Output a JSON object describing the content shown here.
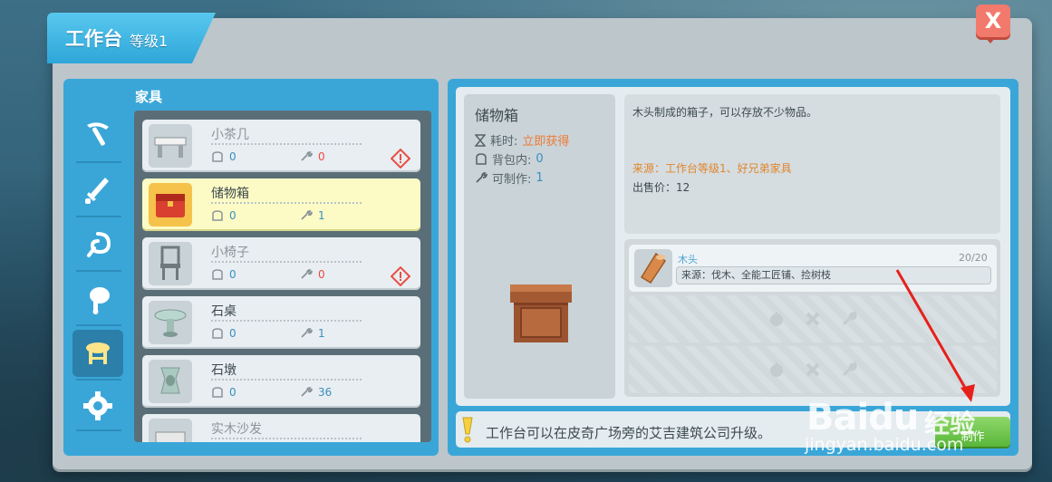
{
  "window": {
    "title": "工作台",
    "level": "等级1"
  },
  "close": {
    "icon": "close-icon",
    "symbol": "X"
  },
  "category": {
    "title": "家具",
    "tabs": [
      {
        "name": "tools",
        "icon": "pickaxe-icon",
        "active": false
      },
      {
        "name": "weapons",
        "icon": "sword-icon",
        "active": false
      },
      {
        "name": "gathering",
        "icon": "hook-icon",
        "active": false
      },
      {
        "name": "food",
        "icon": "meat-icon",
        "active": false
      },
      {
        "name": "furniture",
        "icon": "stool-icon",
        "active": true
      },
      {
        "name": "materials",
        "icon": "gear-icon",
        "active": false
      }
    ]
  },
  "items": [
    {
      "name": "小茶几",
      "bag": "0",
      "craft": "0",
      "available": false,
      "selected": false,
      "warning": true,
      "icon": "tea-table-icon"
    },
    {
      "name": "储物箱",
      "bag": "0",
      "craft": "1",
      "available": true,
      "selected": true,
      "warning": false,
      "icon": "storage-box-icon"
    },
    {
      "name": "小椅子",
      "bag": "0",
      "craft": "0",
      "available": false,
      "selected": false,
      "warning": true,
      "icon": "chair-icon"
    },
    {
      "name": "石桌",
      "bag": "0",
      "craft": "1",
      "available": true,
      "selected": false,
      "warning": false,
      "icon": "stone-table-icon"
    },
    {
      "name": "石墩",
      "bag": "0",
      "craft": "36",
      "available": true,
      "selected": false,
      "warning": false,
      "icon": "stone-stool-icon"
    },
    {
      "name": "实木沙发",
      "bag": "",
      "craft": "",
      "available": false,
      "selected": false,
      "warning": false,
      "icon": "sofa-icon"
    }
  ],
  "detail": {
    "name": "储物箱",
    "time_label": "耗时:",
    "time_value": "立即获得",
    "bag_label": "背包内:",
    "bag_value": "0",
    "craftable_label": "可制作:",
    "craftable_value": "1",
    "description": "木头制成的箱子，可以存放不少物品。",
    "source": "来源：工作台等级1、好兄弟家具",
    "price": "出售价：12"
  },
  "materials": [
    {
      "name": "木头",
      "count": "20/20",
      "source": "来源：伐木、全能工匠铺、捡树枝",
      "icon": "wood-icon"
    }
  ],
  "tip": {
    "text": "工作台可以在皮奇广场旁的艾吉建筑公司升级。"
  },
  "make_button": {
    "label": "制作"
  },
  "watermark": {
    "logo": "Baidu",
    "sub": "经验",
    "url": "jingyan.baidu.com"
  },
  "colors": {
    "accent": "#3aa6d8",
    "highlight": "#fdfbc5",
    "warning": "#e84e45",
    "orange": "#f07a34",
    "button_green": "#59b63a"
  }
}
